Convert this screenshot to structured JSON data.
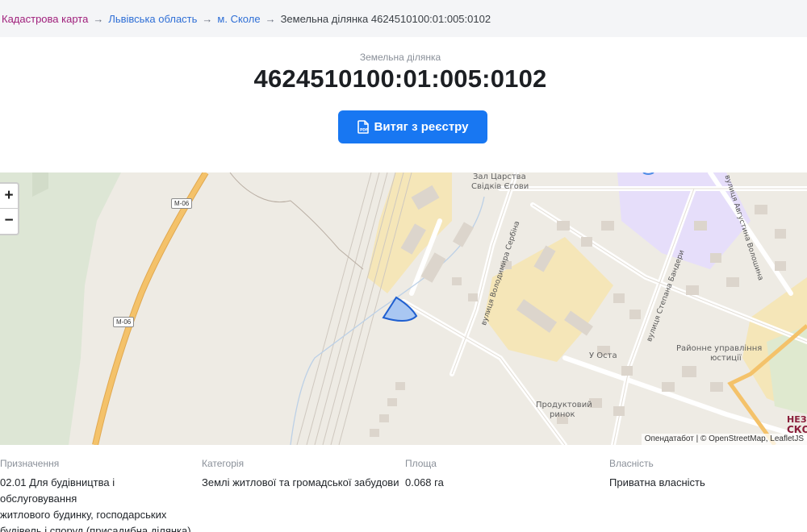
{
  "breadcrumb": {
    "items": [
      "Кадастрова карта",
      "Львівська область",
      "м. Сколе"
    ],
    "current": "Земельна ділянка 4624510100:01:005:0102",
    "separator": "→"
  },
  "header": {
    "label": "Земельна ділянка",
    "number": "4624510100:01:005:0102",
    "extract_button": "Витяг з реєстру",
    "pdf_icon": "pdf-file-icon"
  },
  "map": {
    "zoom_in": "+",
    "zoom_out": "−",
    "attribution": "Опендатабот | © OpenStreetMap, LeafletJS",
    "road_shields": [
      "М-06",
      "М-06"
    ],
    "places": {
      "kingdom_hall_1": "Зал Царства",
      "kingdom_hall_2": "Свідків Єгови",
      "admin_1": "Районне управління",
      "admin_2": "юстиції",
      "market_1": "Продуктовий",
      "market_2": "ринок",
      "u_osta": "У Оста",
      "city_logo_1": "НЕЗ",
      "city_logo_2": "СКО"
    },
    "streets": {
      "serbina": "вулиця Володимира Сербіна",
      "bandery": "вулиця Степана Бандери",
      "voloshyna": "вулиця Августина Волошина"
    },
    "colors": {
      "parcel_fill": "#a9c7f2",
      "parcel_stroke": "#1f5fd0",
      "highway": "#f4c26a",
      "forest": "#dde6d5",
      "residential": "#f5e6b8",
      "education": "#e6defa"
    }
  },
  "info": {
    "purpose": {
      "heading": "Призначення",
      "lines": [
        "02.01 Для будівництва і обслуговування",
        "житлового будинку, господарських",
        "будівель і споруд (присадибна ділянка)"
      ]
    },
    "category": {
      "heading": "Категорія",
      "value": "Землі житлової та громадської забудови"
    },
    "area": {
      "heading": "Площа",
      "value": "0.068 га"
    },
    "ownership": {
      "heading": "Власність",
      "value": "Приватна власність"
    }
  }
}
